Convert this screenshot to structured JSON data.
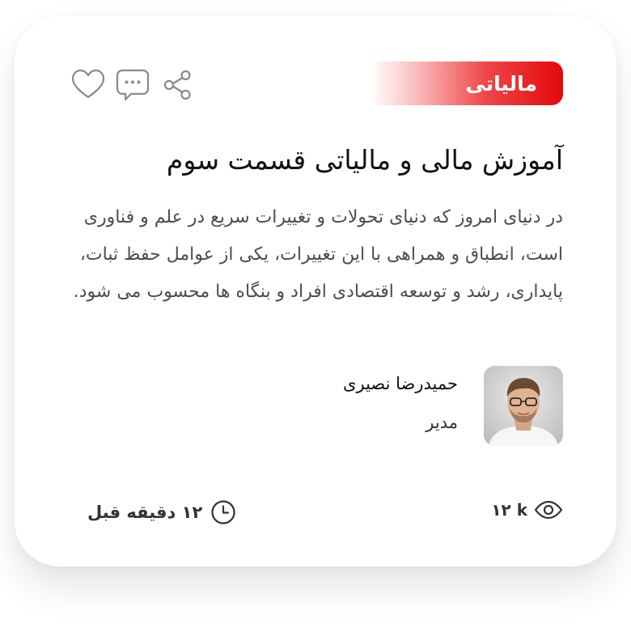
{
  "card": {
    "category": "مالیاتی",
    "title": "آموزش مالی و مالیاتی قسمت سوم",
    "description": "در دنیای امروز که دنیای تحولات و تغییرات سریع در علم و فناوری است، انطباق و همراهی با این تغییرات، یکی از عوامل حفظ ثبات، پایداری، رشد و توسعه اقتصادی افراد و بنگاه ها محسوب می شود.",
    "author": {
      "name": "حمیدرضا نصیری",
      "role": "مدیر"
    },
    "stats": {
      "views": "۱۲ k",
      "time_ago": "۱۲ دقیقه قبل"
    },
    "actions": {
      "like_icon": "heart-icon",
      "comment_icon": "comment-icon",
      "share_icon": "share-icon"
    },
    "colors": {
      "accent": "#e4080a",
      "text": "#1a1a1a",
      "muted": "#4d4d4d",
      "icon": "#8a8a8a"
    }
  }
}
